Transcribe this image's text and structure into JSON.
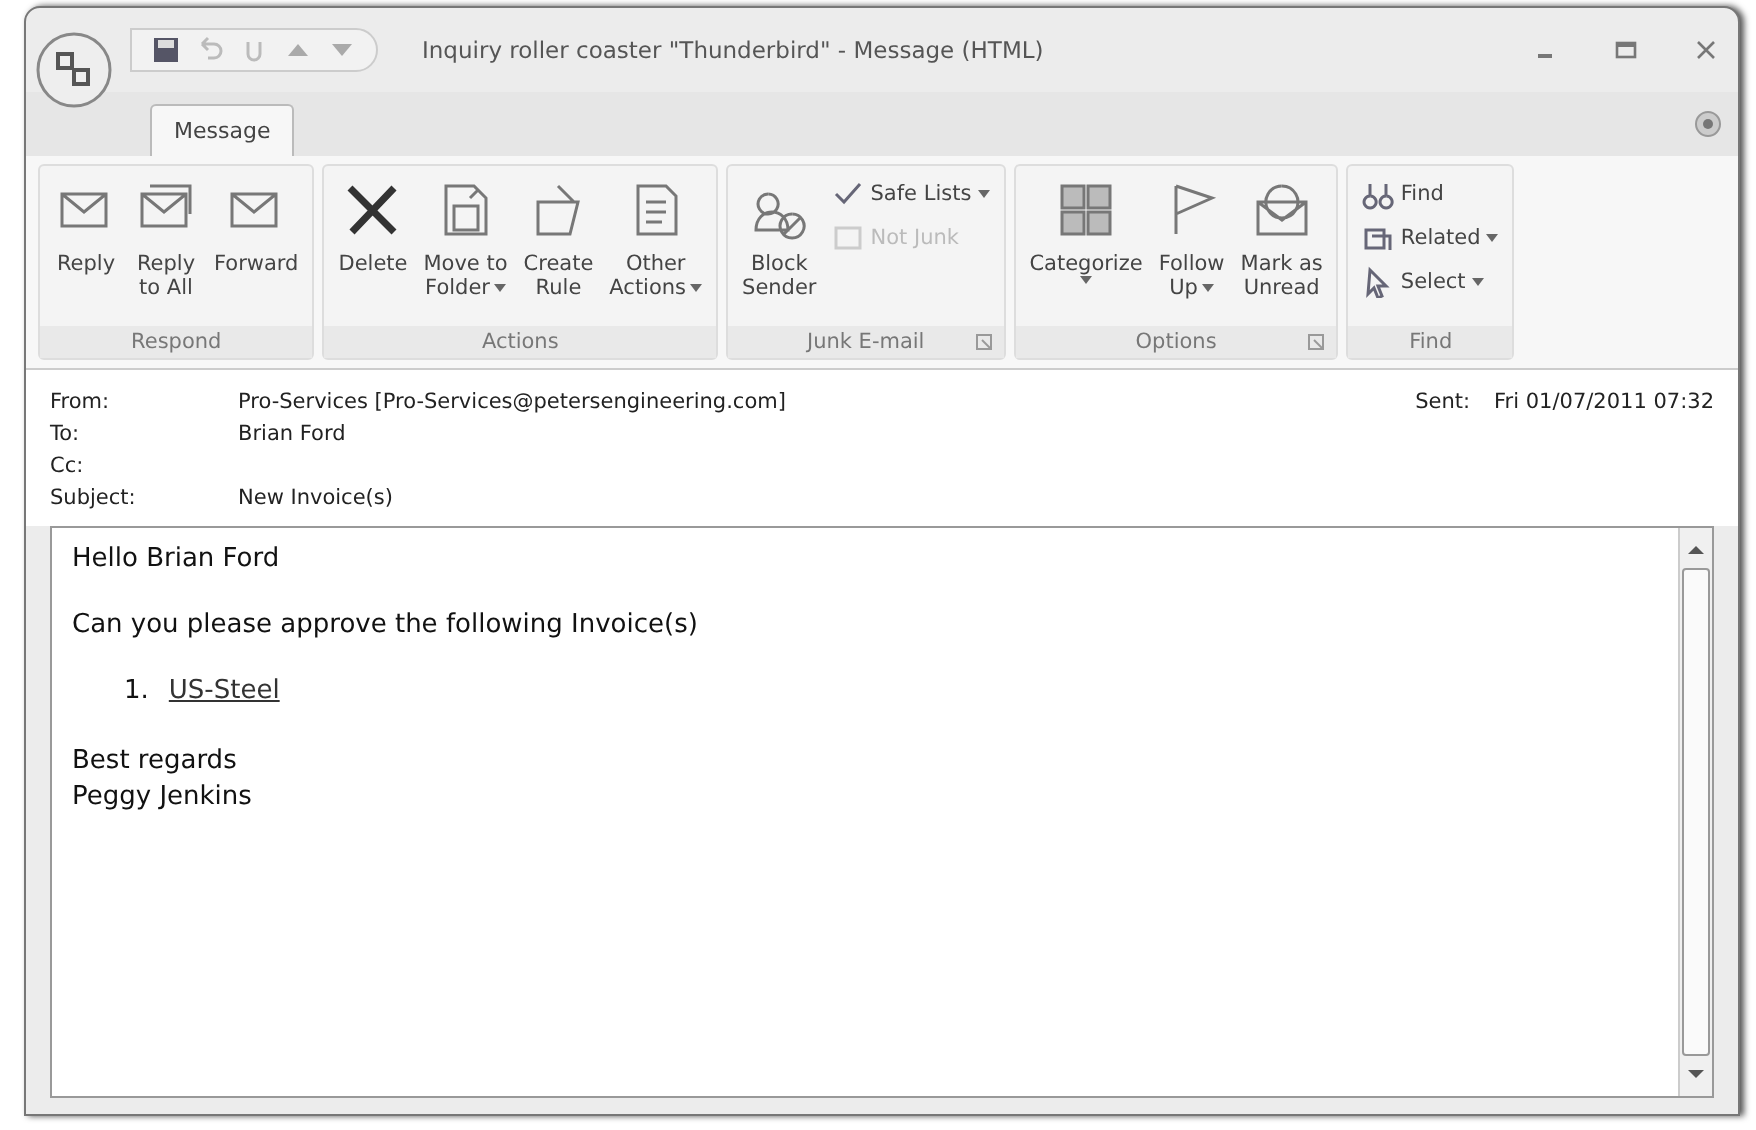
{
  "window": {
    "title": "Inquiry roller coaster \"Thunderbird\" - Message (HTML)"
  },
  "tabs": [
    {
      "label": "Message",
      "selected": true
    }
  ],
  "ribbon": {
    "groups": [
      {
        "label": "Respond",
        "launcher": false,
        "buttons": [
          {
            "kind": "large",
            "lines": [
              "Reply"
            ],
            "dropdown": false,
            "disabled": false
          },
          {
            "kind": "large",
            "lines": [
              "Reply",
              "to All"
            ],
            "dropdown": false,
            "disabled": false
          },
          {
            "kind": "large",
            "lines": [
              "Forward"
            ],
            "dropdown": false,
            "disabled": false
          }
        ]
      },
      {
        "label": "Actions",
        "launcher": false,
        "buttons": [
          {
            "kind": "large",
            "lines": [
              "Delete"
            ],
            "dropdown": false,
            "disabled": false
          },
          {
            "kind": "large",
            "lines": [
              "Move to",
              "Folder"
            ],
            "dropdown": true,
            "disabled": false
          },
          {
            "kind": "large",
            "lines": [
              "Create",
              "Rule"
            ],
            "dropdown": false,
            "disabled": false
          },
          {
            "kind": "large",
            "lines": [
              "Other",
              "Actions"
            ],
            "dropdown": true,
            "disabled": false
          }
        ]
      },
      {
        "label": "Junk E-mail",
        "launcher": true,
        "buttons": [
          {
            "kind": "large",
            "lines": [
              "Block",
              "Sender"
            ],
            "dropdown": false,
            "disabled": false
          },
          {
            "kind": "stack",
            "items": [
              {
                "label": "Safe Lists",
                "dropdown": true,
                "disabled": false
              },
              {
                "label": "Not Junk",
                "dropdown": false,
                "disabled": true
              }
            ]
          }
        ]
      },
      {
        "label": "Options",
        "launcher": true,
        "buttons": [
          {
            "kind": "large",
            "lines": [
              "Categorize"
            ],
            "dropdown": true,
            "disabled": false
          },
          {
            "kind": "large",
            "lines": [
              "Follow",
              "Up"
            ],
            "dropdown": true,
            "disabled": false
          },
          {
            "kind": "large",
            "lines": [
              "Mark as",
              "Unread"
            ],
            "dropdown": false,
            "disabled": false
          }
        ]
      },
      {
        "label": "Find",
        "launcher": false,
        "buttons": [
          {
            "kind": "stack",
            "items": [
              {
                "label": "Find",
                "dropdown": false,
                "disabled": false
              },
              {
                "label": "Related",
                "dropdown": true,
                "disabled": false
              },
              {
                "label": "Select",
                "dropdown": true,
                "disabled": false
              }
            ]
          }
        ]
      }
    ]
  },
  "header": {
    "fields": [
      {
        "label": "From:",
        "value": "Pro-Services [Pro-Services@petersengineering.com]"
      },
      {
        "label": "To:",
        "value": "Brian Ford"
      },
      {
        "label": "Cc:"
      },
      {
        "label": "Subject:",
        "value": "New Invoice(s)"
      }
    ],
    "sent": {
      "label": "Sent:",
      "value": "Fri 01/07/2011 07:32"
    }
  },
  "body": {
    "greeting": "Hello Brian Ford",
    "request": "Can you please approve the following Invoice(s)",
    "list": [
      {
        "number": "1.",
        "link": "US-Steel"
      }
    ],
    "closing": "Best regards",
    "signature": "Peggy Jenkins"
  }
}
